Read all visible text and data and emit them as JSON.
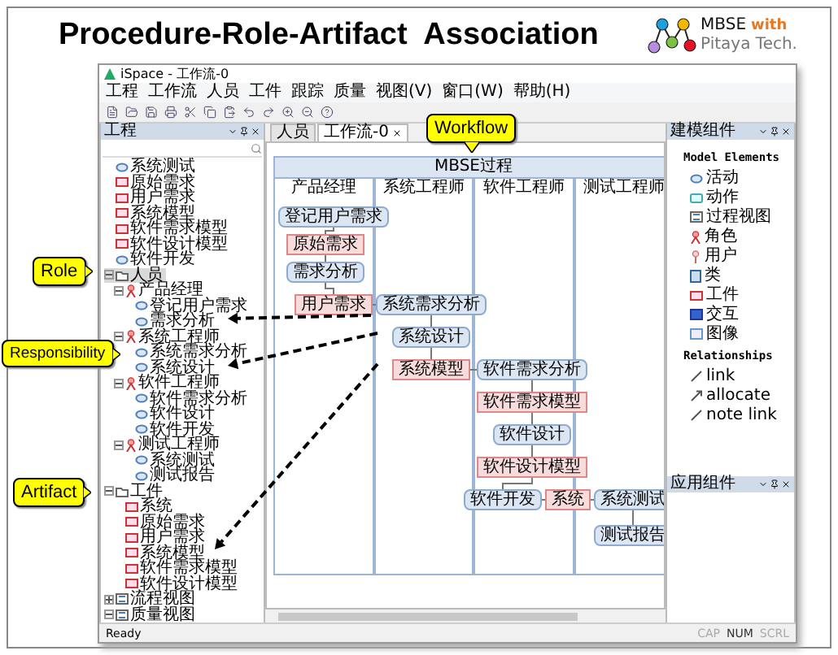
{
  "slide": {
    "title": "Procedure-Role-Artifact  Association"
  },
  "logo": {
    "line_1": "MBSE",
    "accent": "with",
    "line_2": "Pitaya Tech."
  },
  "window": {
    "title": "iSpace - 工作流-0"
  },
  "menu": [
    "工程",
    "工作流",
    "人员",
    "工件",
    "跟踪",
    "质量",
    "视图(V)",
    "窗口(W)",
    "帮助(H)"
  ],
  "left_panel": {
    "title": "工程"
  },
  "tree": [
    {
      "label": "系统测试",
      "kind": "activity",
      "selected": false
    },
    {
      "label": "原始需求",
      "kind": "artifact",
      "selected": false
    },
    {
      "label": "用户需求",
      "kind": "artifact",
      "selected": false
    },
    {
      "label": "系统模型",
      "kind": "artifact",
      "selected": false
    },
    {
      "label": "软件需求模型",
      "kind": "artifact",
      "selected": false
    },
    {
      "label": "软件设计模型",
      "kind": "artifact",
      "selected": false
    },
    {
      "label": "软件开发",
      "kind": "activity",
      "selected": false
    },
    {
      "label": "人员",
      "kind": "folder",
      "selected": true,
      "expanded": true,
      "children": [
        {
          "label": "产品经理",
          "kind": "role",
          "selected": false,
          "expanded": true,
          "children": [
            {
              "label": "登记用户需求",
              "kind": "activity",
              "selected": false
            },
            {
              "label": "需求分析",
              "kind": "activity",
              "selected": false
            }
          ]
        },
        {
          "label": "系统工程师",
          "kind": "role",
          "selected": false,
          "expanded": true,
          "children": [
            {
              "label": "系统需求分析",
              "kind": "activity",
              "selected": false
            },
            {
              "label": "系统设计",
              "kind": "activity",
              "selected": false
            }
          ]
        },
        {
          "label": "软件工程师",
          "kind": "role",
          "selected": false,
          "expanded": true,
          "children": [
            {
              "label": "软件需求分析",
              "kind": "activity",
              "selected": false
            },
            {
              "label": "软件设计",
              "kind": "activity",
              "selected": false
            },
            {
              "label": "软件开发",
              "kind": "activity",
              "selected": false
            }
          ]
        },
        {
          "label": "测试工程师",
          "kind": "role",
          "selected": false,
          "expanded": true,
          "children": [
            {
              "label": "系统测试",
              "kind": "activity",
              "selected": false
            },
            {
              "label": "测试报告",
              "kind": "activity",
              "selected": false
            }
          ]
        }
      ]
    },
    {
      "label": "工件",
      "kind": "folder",
      "selected": false,
      "expanded": true,
      "children": [
        {
          "label": "系统",
          "kind": "artifact",
          "selected": false
        },
        {
          "label": "原始需求",
          "kind": "artifact",
          "selected": false
        },
        {
          "label": "用户需求",
          "kind": "artifact",
          "selected": false
        },
        {
          "label": "系统模型",
          "kind": "artifact",
          "selected": false
        },
        {
          "label": "软件需求模型",
          "kind": "artifact",
          "selected": false
        },
        {
          "label": "软件设计模型",
          "kind": "artifact",
          "selected": false
        }
      ]
    },
    {
      "label": "流程视图",
      "kind": "view",
      "selected": false,
      "expanded": false
    },
    {
      "label": "质量视图",
      "kind": "view",
      "selected": false,
      "expanded": true
    }
  ],
  "tabs": [
    {
      "label": "人员",
      "selected": false
    },
    {
      "label": "工作流-0",
      "selected": true
    }
  ],
  "diagram": {
    "title": "MBSE过程",
    "lanes": [
      "产品经理",
      "系统工程师",
      "软件工程师",
      "测试工程师"
    ],
    "nodes": [
      {
        "label": "登记用户需求",
        "kind": "activity"
      },
      {
        "label": "原始需求",
        "kind": "artifact"
      },
      {
        "label": "需求分析",
        "kind": "activity"
      },
      {
        "label": "用户需求",
        "kind": "artifact"
      },
      {
        "label": "系统需求分析",
        "kind": "activity"
      },
      {
        "label": "系统设计",
        "kind": "activity"
      },
      {
        "label": "系统模型",
        "kind": "artifact"
      },
      {
        "label": "软件需求分析",
        "kind": "activity"
      },
      {
        "label": "软件需求模型",
        "kind": "artifact"
      },
      {
        "label": "软件设计",
        "kind": "activity"
      },
      {
        "label": "软件设计模型",
        "kind": "artifact"
      },
      {
        "label": "软件开发",
        "kind": "activity"
      },
      {
        "label": "系统",
        "kind": "artifact"
      },
      {
        "label": "系统测试",
        "kind": "activity"
      },
      {
        "label": "测试报告",
        "kind": "activity"
      }
    ]
  },
  "palette": {
    "title": "建模组件",
    "sections": [
      {
        "heading": "Model Elements",
        "items": [
          {
            "label": "活动",
            "kind": "activity"
          },
          {
            "label": "动作",
            "kind": "action"
          },
          {
            "label": "过程视图",
            "kind": "view"
          },
          {
            "label": "角色",
            "kind": "role"
          },
          {
            "label": "用户",
            "kind": "user"
          },
          {
            "label": "类",
            "kind": "class"
          },
          {
            "label": "工件",
            "kind": "artifact"
          },
          {
            "label": "交互",
            "kind": "interaction"
          },
          {
            "label": "图像",
            "kind": "image"
          }
        ]
      },
      {
        "heading": "Relationships",
        "items": [
          {
            "label": "link",
            "kind": "link"
          },
          {
            "label": "allocate",
            "kind": "allocate"
          },
          {
            "label": "note link",
            "kind": "link"
          }
        ]
      }
    ]
  },
  "app_panel": {
    "title": "应用组件"
  },
  "status_bar": {
    "text": "Ready",
    "indicators": [
      {
        "label": "CAP",
        "on": false
      },
      {
        "label": "NUM",
        "on": true
      },
      {
        "label": "SCRL",
        "on": false
      }
    ]
  },
  "callouts": [
    {
      "label": "Workflow"
    },
    {
      "label": "Role"
    },
    {
      "label": "Responsibility"
    },
    {
      "label": "Artifact"
    }
  ]
}
